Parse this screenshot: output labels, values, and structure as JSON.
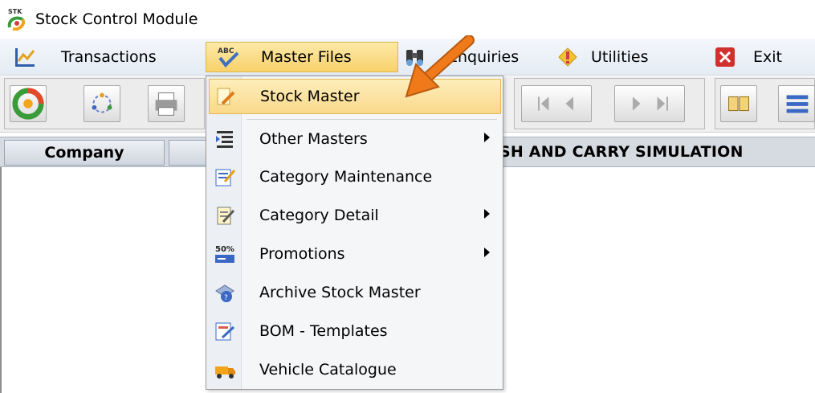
{
  "window": {
    "title": "Stock Control Module"
  },
  "menubar": {
    "items": [
      {
        "label": "Transactions",
        "icon": "chart-icon"
      },
      {
        "label": "Master Files",
        "icon": "abc-check-icon",
        "active": true
      },
      {
        "label": "Enquiries",
        "icon": "binoculars-icon"
      },
      {
        "label": "Utilities",
        "icon": "tools-icon"
      },
      {
        "label": "Exit",
        "icon": "close-icon"
      }
    ]
  },
  "grid": {
    "columns": [
      "Company",
      "",
      "SH AND CARRY SIMULATION"
    ]
  },
  "dropdown": {
    "items": [
      {
        "label": "Stock Master",
        "icon": "document-pen-icon",
        "highlighted": true,
        "submenu": false
      },
      {
        "label": "Other Masters",
        "icon": "indent-list-icon",
        "submenu": true
      },
      {
        "label": "Category Maintenance",
        "icon": "edit-form-icon",
        "submenu": false
      },
      {
        "label": "Category Detail",
        "icon": "notepad-pen-icon",
        "submenu": true
      },
      {
        "label": "Promotions",
        "icon": "percent-tag-icon",
        "badge": "50%",
        "submenu": true
      },
      {
        "label": "Archive Stock Master",
        "icon": "archive-disk-icon",
        "submenu": false
      },
      {
        "label": "BOM - Templates",
        "icon": "template-pen-icon",
        "submenu": false
      },
      {
        "label": "Vehicle Catalogue",
        "icon": "truck-icon",
        "submenu": false
      }
    ]
  },
  "colors": {
    "highlight": "#f9d98b",
    "menu_active": "#f8d26b",
    "arrow": "#f07a1a",
    "exit_red": "#d0312d"
  }
}
